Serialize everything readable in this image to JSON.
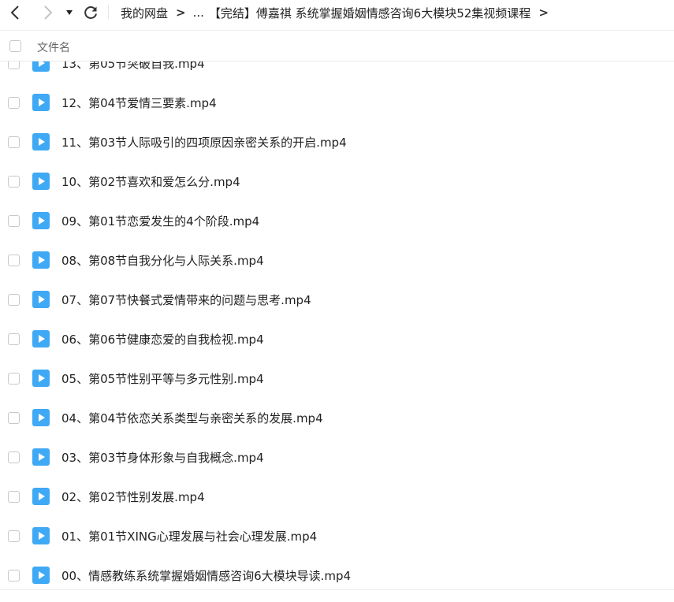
{
  "breadcrumb": {
    "root": "我的网盘",
    "ellipsis": "...",
    "current": "【完结】傅嘉祺 系统掌握婚姻情感咨询6大模块52集视频课程"
  },
  "list_header": {
    "name_column": "文件名"
  },
  "files": [
    {
      "name": "13、第05节突破自我.mp4"
    },
    {
      "name": "12、第04节爱情三要素.mp4"
    },
    {
      "name": "11、第03节人际吸引的四项原因亲密关系的开启.mp4"
    },
    {
      "name": "10、第02节喜欢和爱怎么分.mp4"
    },
    {
      "name": "09、第01节恋爱发生的4个阶段.mp4"
    },
    {
      "name": "08、第08节自我分化与人际关系.mp4"
    },
    {
      "name": "07、第07节快餐式爱情带来的问题与思考.mp4"
    },
    {
      "name": "06、第06节健康恋爱的自我检视.mp4"
    },
    {
      "name": "05、第05节性别平等与多元性别.mp4"
    },
    {
      "name": "04、第04节依恋关系类型与亲密关系的发展.mp4"
    },
    {
      "name": "03、第03节身体形象与自我概念.mp4"
    },
    {
      "name": "02、第02节性别发展.mp4"
    },
    {
      "name": "01、第01节XING心理发展与社会心理发展.mp4"
    },
    {
      "name": "00、情感教练系统掌握婚姻情感咨询6大模块导读.mp4"
    }
  ],
  "icons": {
    "back": "back-arrow-icon",
    "forward": "forward-arrow-icon",
    "history": "dropdown-triangle-icon",
    "refresh": "refresh-icon",
    "file": "video-file-icon"
  },
  "colors": {
    "video_icon": "#3fa9f5",
    "text": "#222222"
  }
}
